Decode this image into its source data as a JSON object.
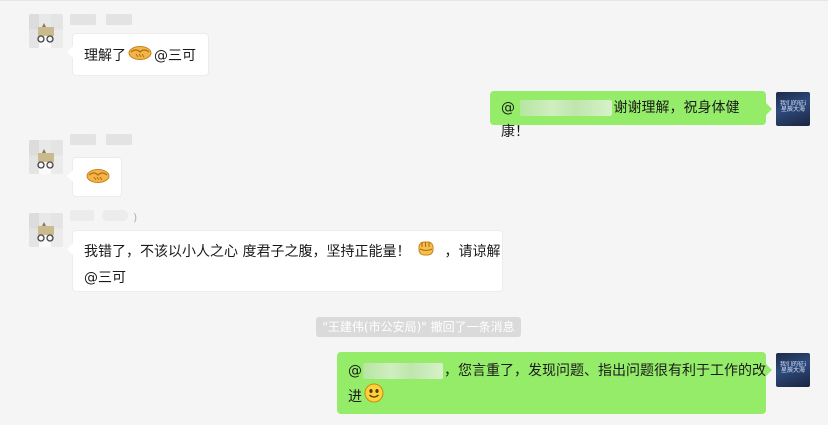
{
  "messages": [
    {
      "side": "left",
      "avatar": "cat-avatar",
      "text_before": "理解了",
      "icon": "handshake-icon",
      "text_after": "@三可"
    },
    {
      "side": "right",
      "avatar": "blue-avatar",
      "text_prefix": "@ ",
      "text_after": "谢谢理解，祝身体健康！"
    },
    {
      "side": "left",
      "avatar": "cat-avatar",
      "icon": "handshake-icon"
    },
    {
      "side": "left",
      "avatar": "cat-avatar",
      "line1_before": "我错了，不该以小人之心 度君子之腹，坚持正能量！",
      "icon": "fist-icon",
      "line1_after": "，请谅解",
      "line2": "@三可",
      "paren": ")"
    },
    {
      "side": "right",
      "avatar": "blue-avatar",
      "text_prefix": "@",
      "line1_after": "，您言重了，发现问题、指出问题很有利于工作的改",
      "line2": "进",
      "icon": "smile-icon"
    }
  ],
  "system_notice": "\"王建伟(市公安局)\" 撤回了一条消息",
  "blue_avatar_text": {
    "line1": "我们的征途是",
    "line2": "星辰大海"
  },
  "colors": {
    "background": "#f5f5f5",
    "sent_bubble": "#95ec69",
    "received_bubble": "#ffffff",
    "notice_bg": "#dadada"
  }
}
